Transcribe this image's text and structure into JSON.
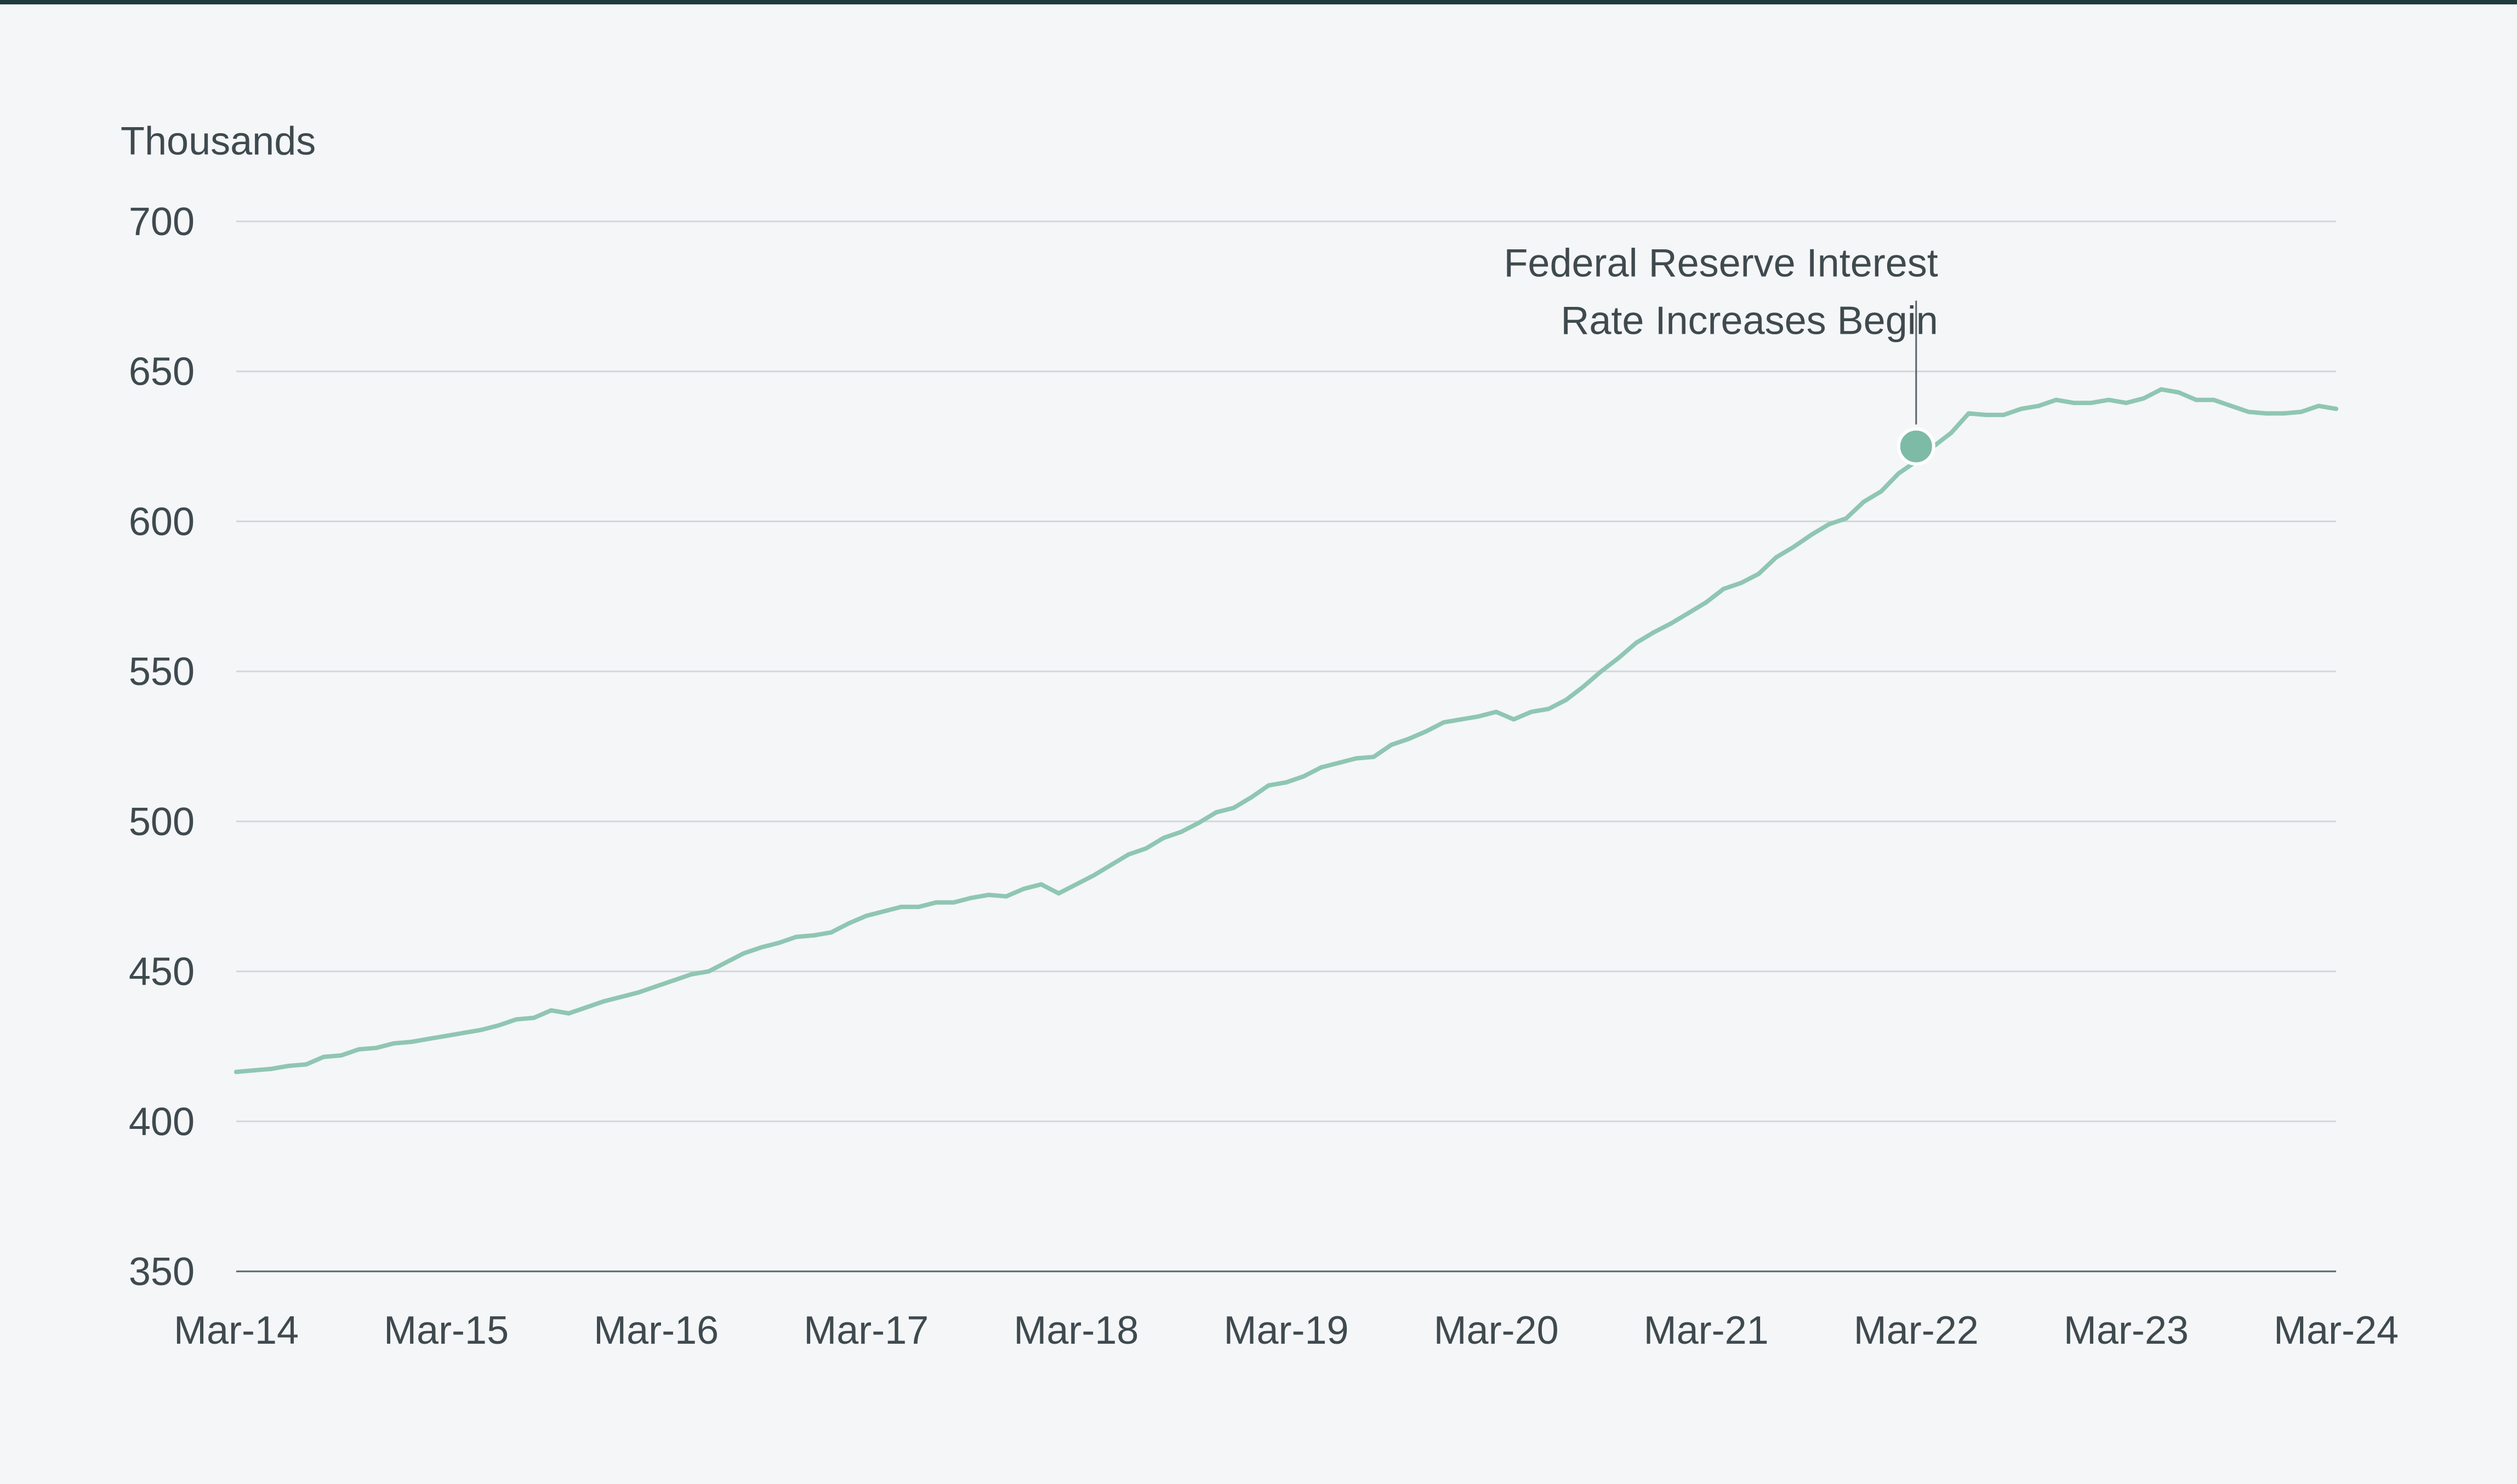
{
  "colors": {
    "line": "#8fc6b2",
    "marker": "#7dbba7",
    "grid": "#d3d7da",
    "axis": "#5a6468",
    "text": "#3f4a4f",
    "background": "#f4f6f8"
  },
  "chart_data": {
    "type": "line",
    "ylabel": "Thousands",
    "ylim": [
      350,
      700
    ],
    "yticks": [
      350,
      400,
      450,
      500,
      550,
      600,
      650,
      700
    ],
    "x_tick_labels": [
      "Mar-14",
      "Mar-15",
      "Mar-16",
      "Mar-17",
      "Mar-18",
      "Mar-19",
      "Mar-20",
      "Mar-21",
      "Mar-22",
      "Mar-23",
      "Mar-24"
    ],
    "grid": "horizontal",
    "x_start": "2014-03",
    "series": [
      {
        "values": [
          416.5,
          417,
          417.5,
          418.5,
          419,
          421.5,
          422,
          424,
          424.5,
          426,
          426.5,
          427.5,
          428.5,
          429.5,
          430.5,
          432,
          434,
          434.5,
          437,
          436,
          438,
          440,
          441.5,
          443,
          445,
          447,
          449,
          450,
          453,
          456,
          458,
          459.5,
          461.5,
          462,
          463,
          466,
          468.5,
          470,
          471.5,
          471.5,
          473,
          473,
          474.5,
          475.5,
          475,
          477.5,
          479,
          476,
          479,
          482,
          485.5,
          489,
          491,
          494.5,
          496.5,
          499.5,
          503,
          504.5,
          508,
          512,
          513,
          515,
          518,
          519.5,
          521,
          521.5,
          525.5,
          527.5,
          530,
          533,
          534,
          535,
          536.5,
          534,
          536.5,
          537.5,
          540.5,
          545,
          550,
          554.5,
          559.5,
          563,
          566,
          569.5,
          573,
          577.5,
          579.5,
          582.5,
          588,
          591.5,
          595.5,
          599,
          601,
          606.5,
          610,
          616,
          620,
          625,
          629.5,
          636,
          635.5,
          635.5,
          637.5,
          638.5,
          640.5,
          639.5,
          639.5,
          640.5,
          639.5,
          641,
          644,
          643,
          640.5,
          640.5,
          638.5,
          636.5,
          636,
          636,
          636.5,
          638.5,
          637.5
        ]
      }
    ],
    "annotations": [
      {
        "text_line1": "Federal Reserve Interest",
        "text_line2": "Rate Increases Begin",
        "x": "2022-03",
        "y": 625
      }
    ]
  }
}
